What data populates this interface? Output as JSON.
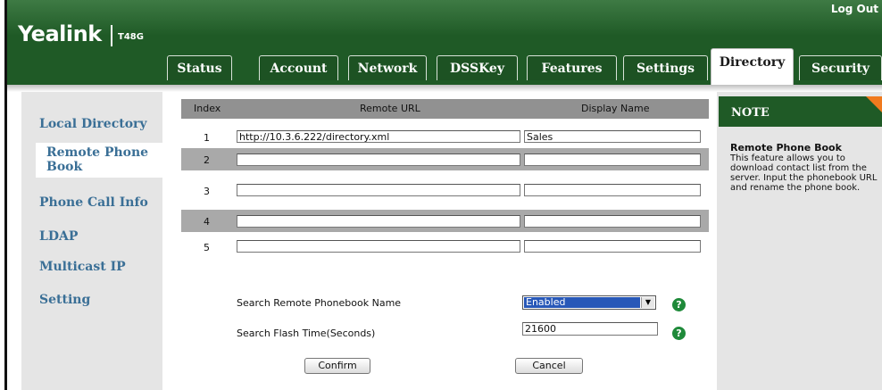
{
  "header": {
    "brand": "Yealink",
    "model": "T48G",
    "logout_label": "Log Out"
  },
  "tabs": [
    {
      "label": "Status"
    },
    {
      "label": "Account"
    },
    {
      "label": "Network"
    },
    {
      "label": "DSSKey"
    },
    {
      "label": "Features"
    },
    {
      "label": "Settings"
    },
    {
      "label": "Directory",
      "active": true
    },
    {
      "label": "Security"
    }
  ],
  "sidebar": {
    "items": [
      {
        "label": "Local Directory"
      },
      {
        "label": "Remote Phone Book",
        "active": true
      },
      {
        "label": "Phone Call Info"
      },
      {
        "label": "LDAP"
      },
      {
        "label": "Multicast IP"
      },
      {
        "label": "Setting"
      }
    ]
  },
  "table": {
    "headers": {
      "index": "Index",
      "url": "Remote URL",
      "name": "Display Name"
    },
    "rows": [
      {
        "index": "1",
        "url": "http://10.3.6.222/directory.xml",
        "name": "Sales"
      },
      {
        "index": "2",
        "url": "",
        "name": ""
      },
      {
        "index": "3",
        "url": "",
        "name": ""
      },
      {
        "index": "4",
        "url": "",
        "name": ""
      },
      {
        "index": "5",
        "url": "",
        "name": ""
      }
    ]
  },
  "settings": {
    "search_name_label": "Search Remote Phonebook Name",
    "search_name_value": "Enabled",
    "flash_time_label": "Search Flash Time(Seconds)",
    "flash_time_value": "21600",
    "help_glyph": "?"
  },
  "buttons": {
    "confirm": "Confirm",
    "cancel": "Cancel"
  },
  "note": {
    "title": "NOTE",
    "subtitle": "Remote Phone Book",
    "text": "This feature allows you to download contact list from the server. Input the phonebook URL and rename the phone book."
  },
  "colors": {
    "header_green": "#1f5a26",
    "link_blue": "#3a6f96",
    "accent_orange": "#f07a1e",
    "help_green": "#1f8a3a"
  }
}
